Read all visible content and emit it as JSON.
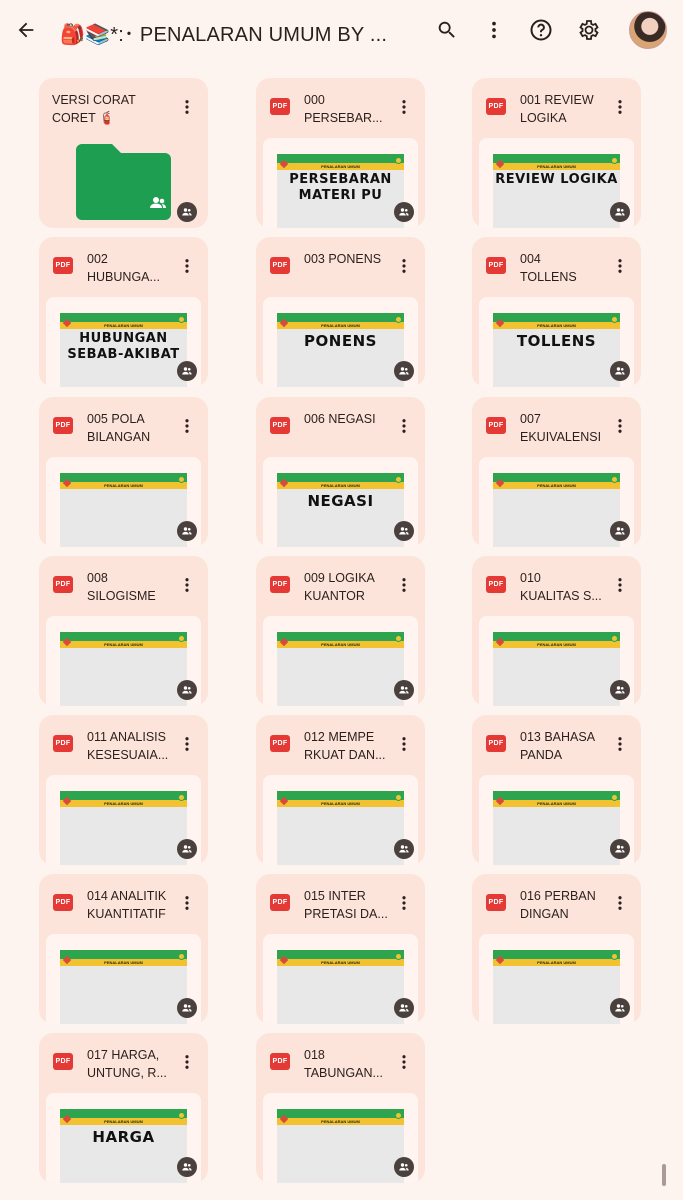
{
  "header": {
    "title": "🎒📚*:･ PENALARAN UMUM BY ..."
  },
  "items": [
    {
      "type": "folder",
      "line1": "VERSI CORAT",
      "line2": "CORET 🧯",
      "thumb": ""
    },
    {
      "type": "pdf",
      "badge": "PDF",
      "line1": "000",
      "line2": "PERSEBAR...",
      "slide_header": "PENALARAN UMUM",
      "thumb": "PERSEBARAN MATERI PU"
    },
    {
      "type": "pdf",
      "badge": "PDF",
      "line1": "001 REVIEW",
      "line2": "LOGIKA",
      "slide_header": "PENALARAN UMUM",
      "thumb": "REVIEW LOGIKA"
    },
    {
      "type": "pdf",
      "badge": "PDF",
      "line1": "002",
      "line2": "HUBUNGA...",
      "slide_header": "PENALARAN UMUM",
      "thumb": "HUBUNGAN SEBAB-AKIBAT"
    },
    {
      "type": "pdf",
      "badge": "PDF",
      "line1": "003 PONENS",
      "line2": "",
      "slide_header": "PENALARAN UMUM",
      "thumb": "PONENS"
    },
    {
      "type": "pdf",
      "badge": "PDF",
      "line1": "004",
      "line2": "TOLLENS",
      "slide_header": "PENALARAN UMUM",
      "thumb": "TOLLENS"
    },
    {
      "type": "pdf",
      "badge": "PDF",
      "line1": "005 POLA",
      "line2": "BILANGAN",
      "slide_header": "PENALARAN UMUM",
      "thumb": ""
    },
    {
      "type": "pdf",
      "badge": "PDF",
      "line1": "006 NEGASI",
      "line2": "",
      "slide_header": "PENALARAN UMUM",
      "thumb": "NEGASI"
    },
    {
      "type": "pdf",
      "badge": "PDF",
      "line1": "007",
      "line2": "EKUIVALENSI",
      "slide_header": "PENALARAN UMUM",
      "thumb": ""
    },
    {
      "type": "pdf",
      "badge": "PDF",
      "line1": "008",
      "line2": "SILOGISME",
      "slide_header": "PENALARAN UMUM",
      "thumb": ""
    },
    {
      "type": "pdf",
      "badge": "PDF",
      "line1": "009 LOGIKA",
      "line2": "KUANTOR",
      "slide_header": "PENALARAN UMUM",
      "thumb": ""
    },
    {
      "type": "pdf",
      "badge": "PDF",
      "line1": "010",
      "line2": "KUALITAS S...",
      "slide_header": "PENALARAN UMUM",
      "thumb": ""
    },
    {
      "type": "pdf",
      "badge": "PDF",
      "line1": "011 ANALISIS",
      "line2": "KESESUAIA...",
      "slide_header": "PENALARAN UMUM",
      "thumb": ""
    },
    {
      "type": "pdf",
      "badge": "PDF",
      "line1": "012 MEMPE",
      "line2": "RKUAT DAN...",
      "slide_header": "PENALARAN UMUM",
      "thumb": ""
    },
    {
      "type": "pdf",
      "badge": "PDF",
      "line1": "013 BAHASA",
      "line2": "PANDA",
      "slide_header": "PENALARAN UMUM",
      "thumb": ""
    },
    {
      "type": "pdf",
      "badge": "PDF",
      "line1": "014 ANALITIK",
      "line2": "KUANTITATIF",
      "slide_header": "PENALARAN UMUM",
      "thumb": ""
    },
    {
      "type": "pdf",
      "badge": "PDF",
      "line1": "015 INTER",
      "line2": "PRETASI DA...",
      "slide_header": "PENALARAN UMUM",
      "thumb": ""
    },
    {
      "type": "pdf",
      "badge": "PDF",
      "line1": "016 PERBAN",
      "line2": "DINGAN",
      "slide_header": "PENALARAN UMUM",
      "thumb": ""
    },
    {
      "type": "pdf",
      "badge": "PDF",
      "line1": "017 HARGA,",
      "line2": "UNTUNG, R...",
      "slide_header": "PENALARAN UMUM",
      "thumb": "HARGA"
    },
    {
      "type": "pdf",
      "badge": "PDF",
      "line1": "018",
      "line2": "TABUNGAN...",
      "slide_header": "PENALARAN UMUM",
      "thumb": ""
    }
  ]
}
